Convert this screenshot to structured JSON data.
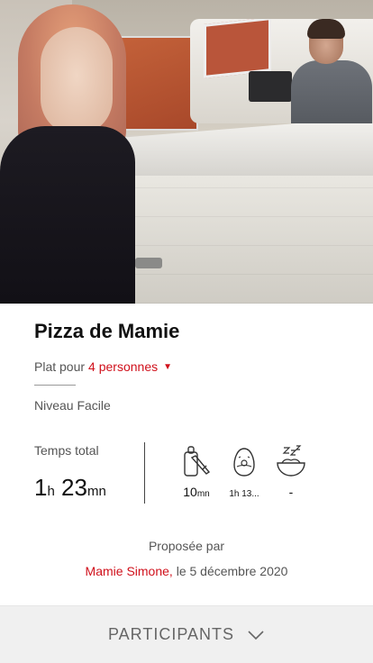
{
  "recipe": {
    "title": "Pizza de Mamie",
    "serving_prefix": "Plat pour",
    "serving_count": "4 personnes",
    "level": "Niveau Facile"
  },
  "times": {
    "total_label": "Temps total",
    "total_hours": "1",
    "total_hours_unit": "h",
    "total_minutes": "23",
    "total_minutes_unit": "mn",
    "prep_value": "10",
    "prep_unit": "mn",
    "cook_value_h": "1",
    "cook_unit_h": "h",
    "cook_value_rest": "13...",
    "rest_value": "-"
  },
  "proposal": {
    "label": "Proposée par",
    "author": "Mamie Simone,",
    "date": " le 5 décembre 2020"
  },
  "footer": {
    "participants_label": "PARTICIPANTS"
  },
  "icons": {
    "prep": "cutting-board-knife-icon",
    "cook": "egg-timer-icon",
    "rest": "bowl-sleep-icon",
    "expand": "chevron-down-icon",
    "dropdown": "caret-down-icon"
  },
  "colors": {
    "accent": "#d0101b",
    "footer_bg": "#f0f0f0"
  }
}
